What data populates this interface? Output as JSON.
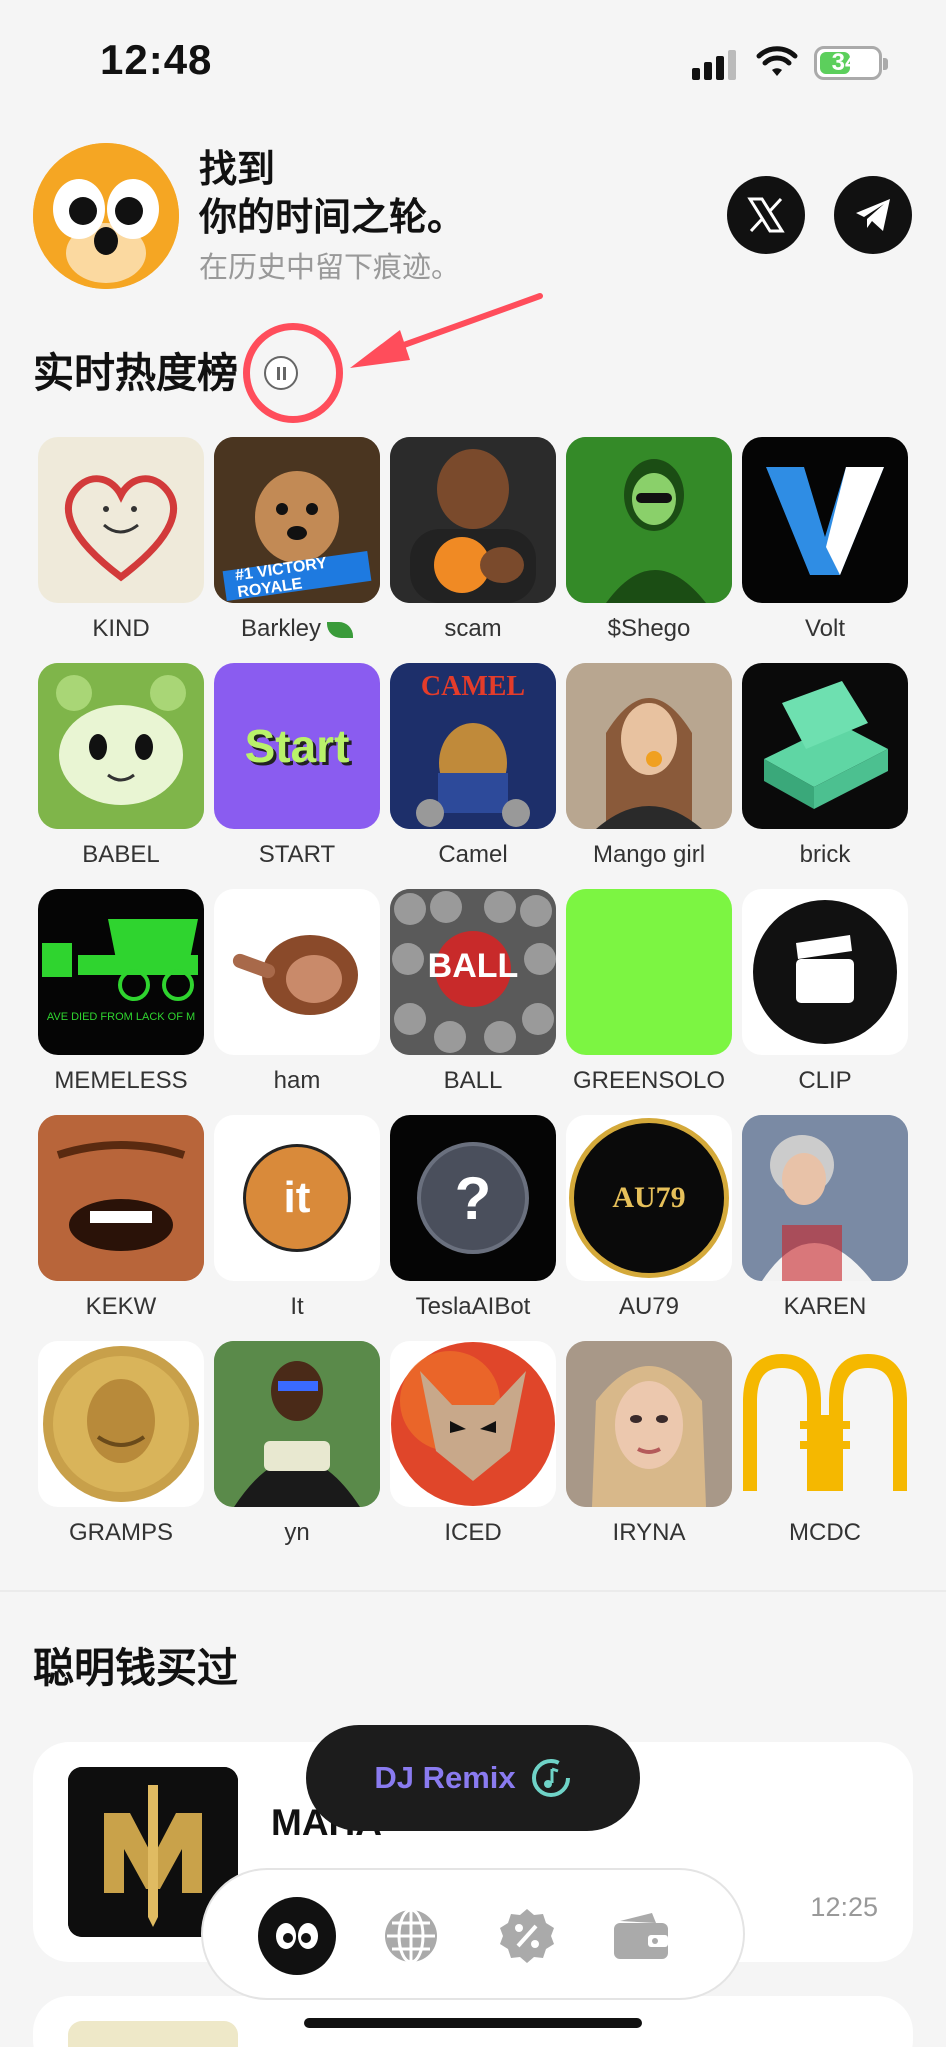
{
  "status_bar": {
    "time": "12:48",
    "battery": "34"
  },
  "header": {
    "title_line1": "找到",
    "title_line2": "你的时间之轮。",
    "subtitle": "在历史中留下痕迹。"
  },
  "trending": {
    "title": "实时热度榜",
    "items": [
      {
        "label": "KIND"
      },
      {
        "label": "Barkley"
      },
      {
        "label": "scam"
      },
      {
        "label": "$Shego"
      },
      {
        "label": "Volt"
      },
      {
        "label": "BABEL"
      },
      {
        "label": "START"
      },
      {
        "label": "Camel"
      },
      {
        "label": "Mango girl"
      },
      {
        "label": "brick"
      },
      {
        "label": "MEMELESS"
      },
      {
        "label": "ham"
      },
      {
        "label": "BALL"
      },
      {
        "label": "GREENSOLO"
      },
      {
        "label": "CLIP"
      },
      {
        "label": "KEKW"
      },
      {
        "label": "It"
      },
      {
        "label": "TeslaAIBot"
      },
      {
        "label": "AU79"
      },
      {
        "label": "KAREN"
      },
      {
        "label": "GRAMPS"
      },
      {
        "label": "yn"
      },
      {
        "label": "ICED"
      },
      {
        "label": "IRYNA"
      },
      {
        "label": "MCDC"
      }
    ],
    "tile_text": {
      "start": "Start",
      "victory1": "#1 VICTORY",
      "victory2": "ROYALE",
      "camel": "CAMEL",
      "memeless": "AVE DIED FROM LACK OF M",
      "ball": "BALL",
      "it": "it",
      "au79": "AU79",
      "question": "?"
    }
  },
  "smart_money": {
    "title": "聪明钱买过",
    "cards": [
      {
        "name": "MAHA",
        "time": "12:25"
      }
    ]
  },
  "dj_pill": {
    "label": "DJ Remix"
  },
  "colors": {
    "accent": "#8a7bf0",
    "highlight": "#ff4d5b",
    "green_tile": "#7cf542"
  }
}
